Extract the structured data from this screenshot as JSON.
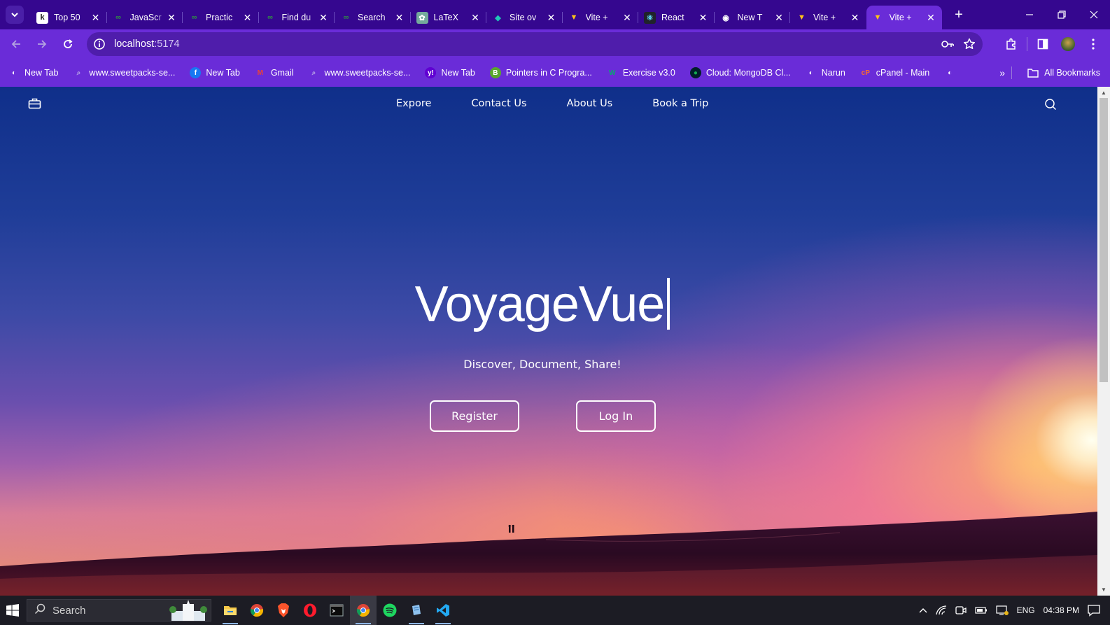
{
  "browser": {
    "tabs": [
      {
        "title": "Top 50",
        "icon": "k-icon",
        "glyph": "k",
        "color": "#1a1a1a",
        "bg": "#ffffff",
        "active": false
      },
      {
        "title": "JavaScr",
        "icon": "gfg-icon",
        "glyph": "∞",
        "color": "#2f8d46",
        "bg": "transparent",
        "active": false
      },
      {
        "title": "Practic",
        "icon": "gfg-icon",
        "glyph": "∞",
        "color": "#2f8d46",
        "bg": "transparent",
        "active": false
      },
      {
        "title": "Find du",
        "icon": "gfg-icon",
        "glyph": "∞",
        "color": "#2f8d46",
        "bg": "transparent",
        "active": false
      },
      {
        "title": "Search",
        "icon": "gfg-icon",
        "glyph": "∞",
        "color": "#2f8d46",
        "bg": "transparent",
        "active": false
      },
      {
        "title": "LaTeX",
        "icon": "chatgpt-icon",
        "glyph": "✿",
        "color": "#ffffff",
        "bg": "#74aa9c",
        "active": false
      },
      {
        "title": "Site ov",
        "icon": "netlify-icon",
        "glyph": "◆",
        "color": "#20c6b7",
        "bg": "transparent",
        "active": false
      },
      {
        "title": "Vite +",
        "icon": "vite-icon",
        "glyph": "▼",
        "color": "#ffc517",
        "bg": "transparent",
        "active": false
      },
      {
        "title": "React",
        "icon": "react-icon",
        "glyph": "⚛",
        "color": "#61dafb",
        "bg": "#20232a",
        "active": false
      },
      {
        "title": "New T",
        "icon": "chrome-icon",
        "glyph": "◉",
        "color": "#ffffff",
        "bg": "transparent",
        "active": false
      },
      {
        "title": "Vite +",
        "icon": "vite-icon",
        "glyph": "▼",
        "color": "#ffc517",
        "bg": "transparent",
        "active": false
      },
      {
        "title": "Vite +",
        "icon": "vite-icon",
        "glyph": "▼",
        "color": "#ffc517",
        "bg": "transparent",
        "active": true
      }
    ],
    "url_host": "localhost",
    "url_port": ":5174",
    "bookmarks": [
      {
        "label": "New Tab",
        "icon": "globe-icon",
        "glyph": "◐",
        "color": "#ffffff",
        "bg": "transparent"
      },
      {
        "label": "www.sweetpacks-se...",
        "icon": "search-icon",
        "glyph": "⌕",
        "color": "#b9a8e6",
        "bg": "transparent"
      },
      {
        "label": "New Tab",
        "icon": "facebook-icon",
        "glyph": "f",
        "color": "#ffffff",
        "bg": "#1877f2"
      },
      {
        "label": "Gmail",
        "icon": "gmail-icon",
        "glyph": "M",
        "color": "#ea4335",
        "bg": "transparent"
      },
      {
        "label": "www.sweetpacks-se...",
        "icon": "search-icon",
        "glyph": "⌕",
        "color": "#b9a8e6",
        "bg": "transparent"
      },
      {
        "label": "New Tab",
        "icon": "yahoo-icon",
        "glyph": "y!",
        "color": "#ffffff",
        "bg": "#6001d2"
      },
      {
        "label": "Pointers in C Progra...",
        "icon": "b-icon",
        "glyph": "B",
        "color": "#ffffff",
        "bg": "#5aa72f"
      },
      {
        "label": "Exercise v3.0",
        "icon": "w3-icon",
        "glyph": "W",
        "color": "#04aa6d",
        "bg": "transparent"
      },
      {
        "label": "Cloud: MongoDB Cl...",
        "icon": "mongodb-icon",
        "glyph": "●",
        "color": "#13aa52",
        "bg": "#001e2b"
      },
      {
        "label": "Narun",
        "icon": "globe-icon",
        "glyph": "◐",
        "color": "#ffffff",
        "bg": "transparent"
      },
      {
        "label": "cPanel - Main",
        "icon": "cpanel-icon",
        "glyph": "cP",
        "color": "#ff6c2c",
        "bg": "transparent"
      },
      {
        "label": "",
        "icon": "globe-icon",
        "glyph": "◐",
        "color": "#ffffff",
        "bg": "transparent"
      }
    ],
    "all_bookmarks": "All Bookmarks"
  },
  "page": {
    "nav": [
      "Expore",
      "Contact Us",
      "About Us",
      "Book a Trip"
    ],
    "title": "VoyageVue",
    "subtitle": "Discover, Document, Share!",
    "register": "Register",
    "login": "Log In"
  },
  "taskbar": {
    "search_placeholder": "Search",
    "language": "ENG",
    "time": "04:38 PM"
  }
}
